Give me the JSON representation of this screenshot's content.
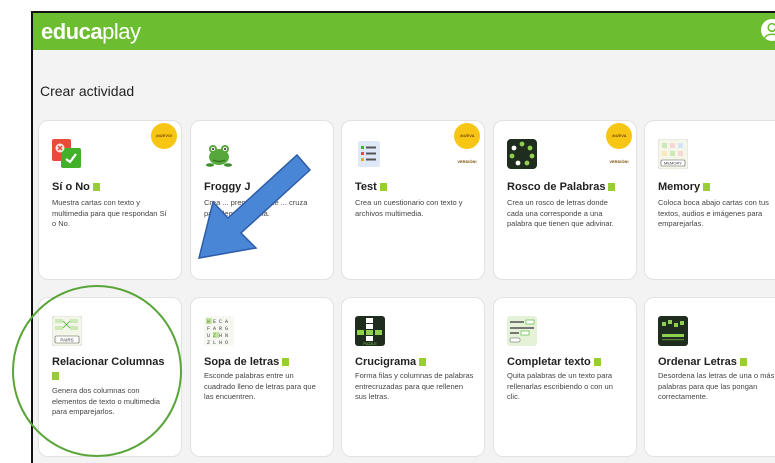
{
  "app": {
    "logo_bold": "educa",
    "logo_light": "play"
  },
  "page": {
    "title": "Crear actividad"
  },
  "colors": {
    "brand_green": "#6cbd2f",
    "badge_yellow": "#f7c514",
    "arrow_blue": "#4a86d6",
    "circle_green": "#5aa53a"
  },
  "badges": {
    "nuevo": "¡NUEVO!",
    "nuevo_version": "¡NUEVA VERSIÓN!"
  },
  "cards": [
    {
      "name": "Sí o No",
      "desc": "Muestra cartas con texto y multimedia para que respondan Sí o No.",
      "icon": "yes-no-icon"
    },
    {
      "name": "Froggy Jumps",
      "name_visible": "Froggy J",
      "desc_visible": "Crea ... preguntas que ... cruza para llegar a ... rilla.",
      "icon": "frog-icon"
    },
    {
      "name": "Test",
      "desc": "Crea un cuestionario con texto y archivos multimedia.",
      "icon": "checklist-icon"
    },
    {
      "name": "Rosco de Palabras",
      "desc": "Crea un rosco de letras donde cada una corresponde a una palabra que tienen que adivinar.",
      "icon": "letter-wheel-icon"
    },
    {
      "name": "Memory",
      "desc": "Coloca boca abajo cartas con tus textos, audios e imágenes para emparejarlas.",
      "icon": "memory-icon"
    },
    {
      "name": "Relacionar Columnas",
      "desc": "Genera dos columnas con elementos de texto o multimedia para emparejarlos.",
      "icon": "pairs-icon"
    },
    {
      "name": "Sopa de letras",
      "desc": "Esconde palabras entre un cuadrado lleno de letras para que las encuentren.",
      "icon": "word-search-icon"
    },
    {
      "name": "Crucigrama",
      "desc": "Forma filas y columnas de palabras entrecruzadas para que rellenen sus letras.",
      "icon": "crossword-icon"
    },
    {
      "name": "Completar texto",
      "desc": "Quita palabras de un texto para rellenarlas escribiendo o con un clic.",
      "icon": "fill-text-icon"
    },
    {
      "name": "Ordenar Letras",
      "desc": "Desordena las letras de una o más palabras para que las pongan correctamente.",
      "icon": "order-letters-icon"
    }
  ]
}
